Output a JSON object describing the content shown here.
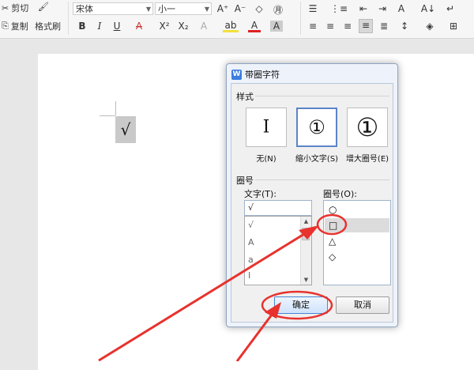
{
  "ribbon": {
    "cut_label": "剪切",
    "copy_label": "复制",
    "format_painter_label": "格式刷",
    "font_name": "宋体",
    "font_size": "小一",
    "glyphs": {
      "cut": "✂",
      "copy": "⎘",
      "brush": "🖌",
      "grow": "A⁺",
      "shrink": "A⁻",
      "clear": "◇",
      "phonetic": "㊊",
      "bullets": "☰",
      "numbering": "⋮≡",
      "indent_dec": "⇤",
      "indent_inc": "⇥",
      "char_a": "A",
      "sort": "A↓",
      "marks": "↵",
      "bold": "B",
      "italic": "I",
      "underline": "U",
      "strike": "A",
      "super": "X²",
      "sub": "X₂",
      "effects": "A",
      "highlight": "ab",
      "fontcolor": "A",
      "charshade": "A",
      "align_left": "≡",
      "align_center": "≡",
      "align_right": "≡",
      "justify": "≡",
      "distribute": "≣",
      "line_spacing": "↕",
      "shading": "◈",
      "borders": "⊞"
    }
  },
  "document": {
    "char": "√"
  },
  "dialog": {
    "title": "带圈字符",
    "app_icon": "W",
    "style_section": "样式",
    "styles": [
      {
        "glyph": "I",
        "caption": "无(N)"
      },
      {
        "glyph": "①",
        "caption": "缩小文字(S)"
      },
      {
        "glyph": "①",
        "caption": "增大圈号(E)"
      }
    ],
    "enclosure_section": "圈号",
    "text_label": "文字(T):",
    "text_value": "√",
    "text_list": [
      "√",
      "A",
      "a",
      "I"
    ],
    "circle_label": "圈号(O):",
    "circle_list": [
      "○",
      "□",
      "△",
      "◇"
    ],
    "ok_label": "确定",
    "cancel_label": "取消"
  },
  "colors": {
    "annotation_red": "#e8322d",
    "dialog_border": "#8ea4c2",
    "selected_style_border": "#5b84c8"
  }
}
